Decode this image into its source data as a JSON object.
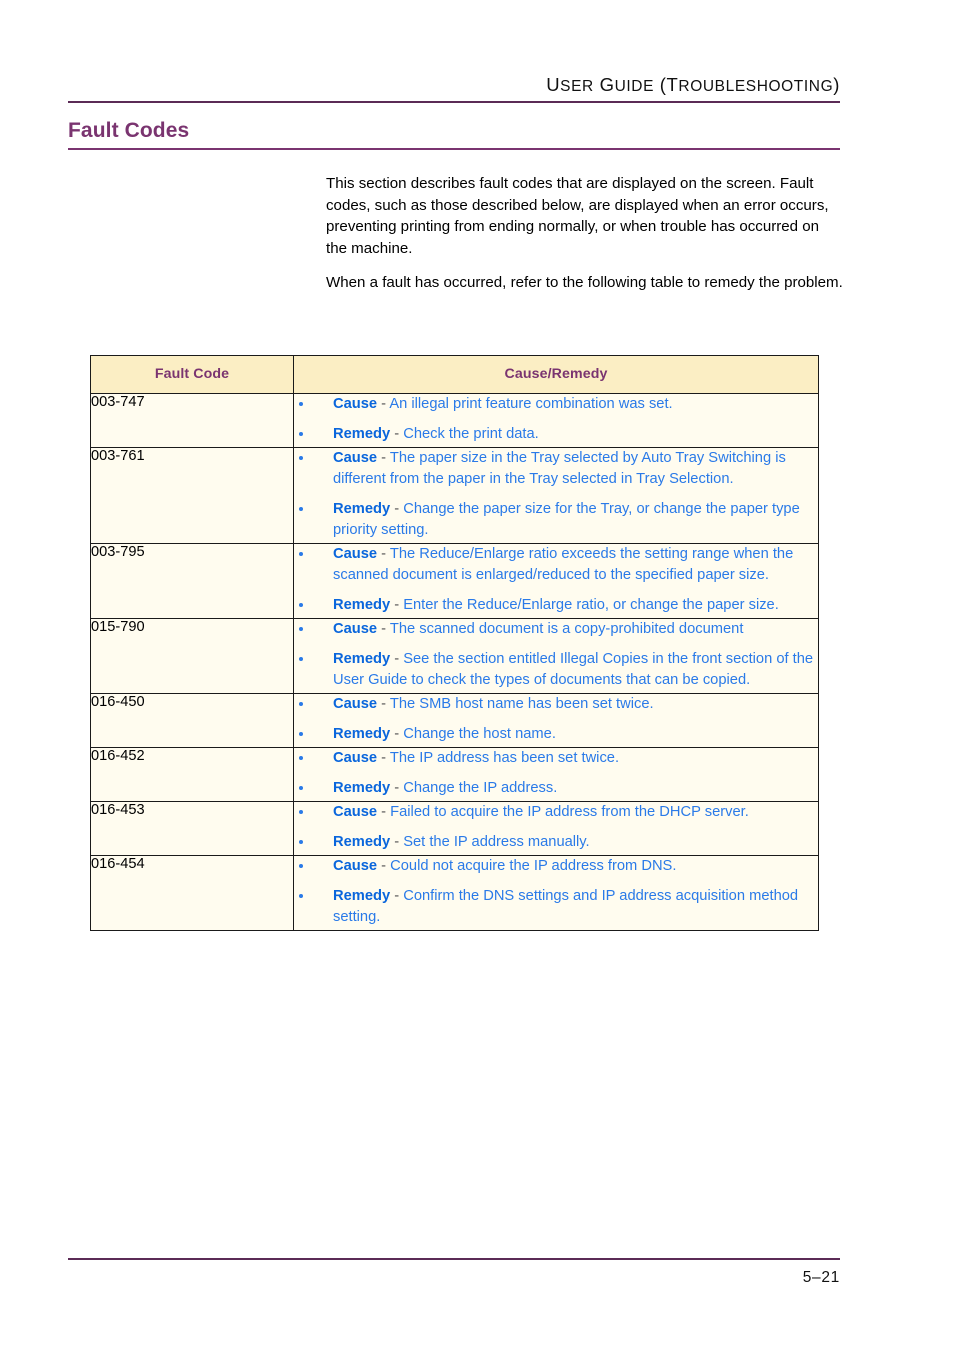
{
  "header": {
    "running_head_parts": [
      {
        "text": "U",
        "caps": true
      },
      {
        "text": "SER",
        "caps": false
      },
      {
        "text": " G",
        "caps": true
      },
      {
        "text": "UIDE",
        "caps": false
      },
      {
        "text": " (T",
        "caps": true
      },
      {
        "text": "ROUBLESHOOTING",
        "caps": false
      },
      {
        "text": ")",
        "caps": true
      }
    ],
    "running_head_text": "USER GUIDE (TROUBLESHOOTING)"
  },
  "section": {
    "title": "Fault Codes",
    "paragraphs": [
      "This section describes fault codes that are displayed on the screen. Fault codes, such as those described below, are displayed when an error occurs, preventing printing from ending normally, or when trouble has occurred on the machine.",
      "When a fault has occurred, refer to the following table to remedy the problem."
    ]
  },
  "table": {
    "columns": [
      "Fault Code",
      "Cause/Remedy"
    ],
    "rows": [
      {
        "code": "003-747",
        "items": [
          {
            "label": "Cause",
            "sep": " - ",
            "text": "An illegal print feature combination was set."
          },
          {
            "label": "Remedy",
            "sep": " - ",
            "text": "Check the print data."
          }
        ]
      },
      {
        "code": "003-761",
        "items": [
          {
            "label": "Cause",
            "sep": " - ",
            "text": "The paper size in the Tray selected by Auto Tray Switching is different from the paper in the Tray selected in Tray Selection."
          },
          {
            "label": "Remedy",
            "sep": " - ",
            "text": "Change the paper size for the Tray, or change the paper type priority setting."
          }
        ]
      },
      {
        "code": "003-795",
        "items": [
          {
            "label": "Cause",
            "sep": " - ",
            "text": "The Reduce/Enlarge ratio exceeds the setting range when the scanned document is enlarged/reduced to the specified paper size."
          },
          {
            "label": "Remedy",
            "sep": " - ",
            "text": "Enter the Reduce/Enlarge ratio, or change the paper size."
          }
        ]
      },
      {
        "code": "015-790",
        "items": [
          {
            "label": "Cause",
            "sep": " - ",
            "text": "The scanned document is a copy-prohibited document"
          },
          {
            "label": "Remedy",
            "sep": " - ",
            "text": "See the section entitled Illegal Copies in the front section of the User Guide to check the types of documents that can be copied."
          }
        ]
      },
      {
        "code": "016-450",
        "items": [
          {
            "label": "Cause",
            "sep": " - ",
            "text": "The SMB host name has been set twice."
          },
          {
            "label": "Remedy",
            "sep": " - ",
            "text": "Change the host name."
          }
        ]
      },
      {
        "code": "016-452",
        "items": [
          {
            "label": "Cause",
            "sep": " - ",
            "text": "The IP address has been set twice."
          },
          {
            "label": "Remedy",
            "sep": " - ",
            "text": "Change the IP address."
          }
        ]
      },
      {
        "code": "016-453",
        "items": [
          {
            "label": "Cause",
            "sep": " - ",
            "text": "Failed to acquire the IP address from the DHCP server."
          },
          {
            "label": "Remedy",
            "sep": " - ",
            "text": "Set the IP address manually."
          }
        ]
      },
      {
        "code": "016-454",
        "items": [
          {
            "label": "Cause",
            "sep": " - ",
            "text": "Could not acquire the IP address from DNS."
          },
          {
            "label": "Remedy",
            "sep": " - ",
            "text": "Confirm the DNS settings and IP address acquisition method setting."
          }
        ]
      }
    ]
  },
  "footer": {
    "page_number": "5–21"
  },
  "colors": {
    "title_purple": "#7a3470",
    "rule_purple": "#5b2b56",
    "header_cell_bg": "#fbeec4",
    "body_cell_bg": "#fffcef",
    "link_blue": "#2a7ae8",
    "label_blue": "#0a66dc",
    "border": "#1a1a1a"
  }
}
